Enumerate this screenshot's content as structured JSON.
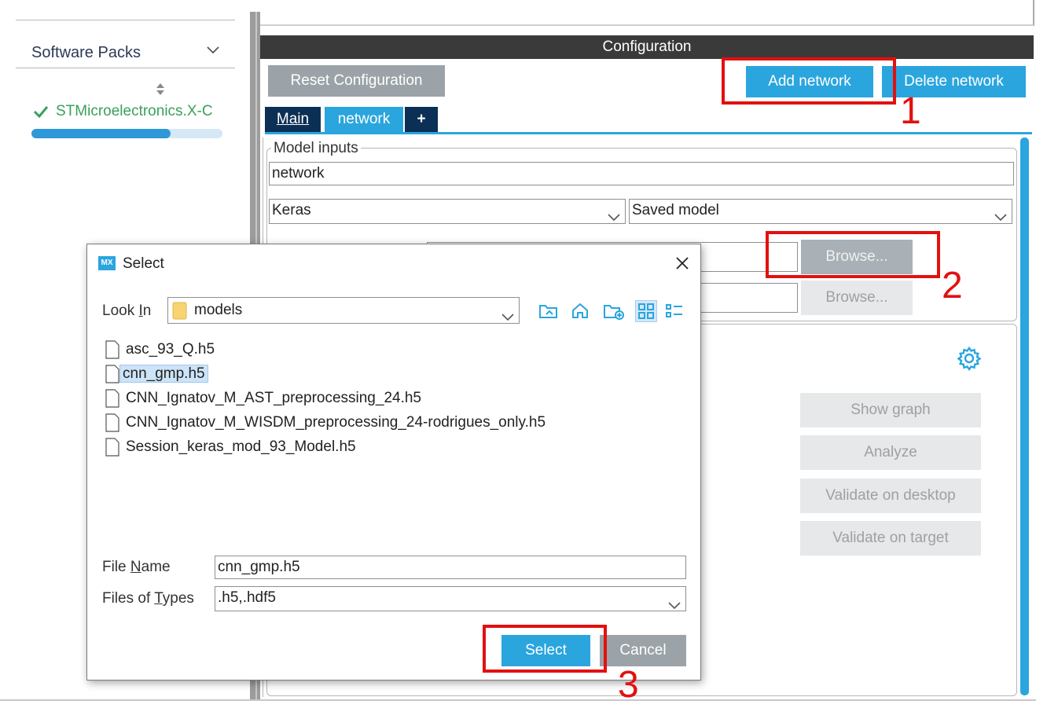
{
  "sidebar": {
    "section_title": "Software Packs",
    "pack_name": "STMicroelectronics.X-C",
    "progress": 0.73
  },
  "config": {
    "header": "Configuration",
    "reset_button": "Reset Configuration",
    "add_network_button": "Add network",
    "delete_network_button": "Delete network",
    "tabs": [
      "Main",
      "network",
      "+"
    ],
    "model_inputs_legend": "Model inputs",
    "network_name_value": "network",
    "framework_select": "Keras",
    "model_type_select": "Saved model",
    "browse_button_1": "Browse...",
    "browse_button_2": "Browse...",
    "actions": [
      "Show graph",
      "Analyze",
      "Validate on desktop",
      "Validate on target"
    ]
  },
  "annotations": [
    "1",
    "2",
    "3"
  ],
  "dialog": {
    "logo_text": "MX",
    "title": "Select",
    "look_in_label_pre": "Look ",
    "look_in_label_u": "I",
    "look_in_label_post": "n",
    "look_in_value": "models",
    "files": [
      "asc_93_Q.h5",
      "cnn_gmp.h5",
      "CNN_Ignatov_M_AST_preprocessing_24.h5",
      "CNN_Ignatov_M_WISDM_preprocessing_24-rodrigues_only.h5",
      "Session_keras_mod_93_Model.h5"
    ],
    "selected_file_index": 1,
    "file_name_label_pre": "File ",
    "file_name_label_u": "N",
    "file_name_label_post": "ame",
    "file_name_value": "cnn_gmp.h5",
    "files_of_types_label_pre": "Files of ",
    "files_of_types_label_u": "T",
    "files_of_types_label_post": "ypes",
    "files_of_types_value": ".h5,.hdf5",
    "select_button": "Select",
    "cancel_button": "Cancel"
  },
  "colors": {
    "accent_blue": "#2aa5de",
    "dark_navy": "#0c2f55",
    "annotation_red": "#e31010",
    "pack_green": "#3aa05a"
  }
}
